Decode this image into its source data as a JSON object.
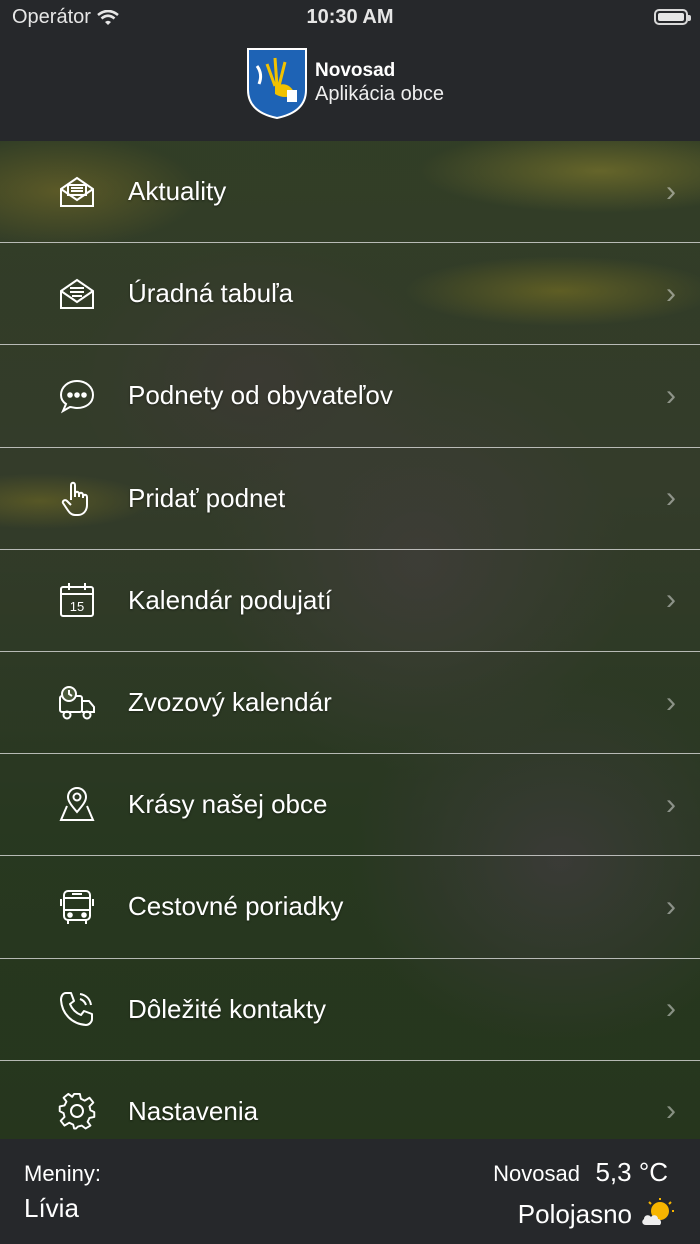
{
  "status_bar": {
    "carrier": "Operátor",
    "time": "10:30 AM"
  },
  "header": {
    "title": "Novosad",
    "subtitle": "Aplikácia obce"
  },
  "menu": [
    {
      "label": "Aktuality",
      "icon": "envelope-open-icon"
    },
    {
      "label": "Úradná tabuľa",
      "icon": "envelope-letter-icon"
    },
    {
      "label": "Podnety od obyvateľov",
      "icon": "chat-bubble-icon"
    },
    {
      "label": "Pridať podnet",
      "icon": "pointer-hand-icon"
    },
    {
      "label": "Kalendár podujatí",
      "icon": "calendar-icon",
      "icon_text": "15"
    },
    {
      "label": "Zvozový kalendár",
      "icon": "delivery-truck-icon"
    },
    {
      "label": "Krásy našej obce",
      "icon": "map-pin-icon"
    },
    {
      "label": "Cestovné poriadky",
      "icon": "bus-icon"
    },
    {
      "label": "Dôležité kontakty",
      "icon": "phone-icon"
    },
    {
      "label": "Nastavenia",
      "icon": "gear-icon"
    }
  ],
  "footer": {
    "nameday_label": "Meniny:",
    "nameday_name": "Lívia",
    "weather_city": "Novosad",
    "weather_temp": "5,3 °C",
    "weather_desc": "Polojasno",
    "weather_icon": "partly-cloudy-icon"
  },
  "colors": {
    "bar_background": "#26282b",
    "text": "#ffffff",
    "crest_blue": "#1e63b5",
    "crest_yellow": "#f2c200"
  }
}
